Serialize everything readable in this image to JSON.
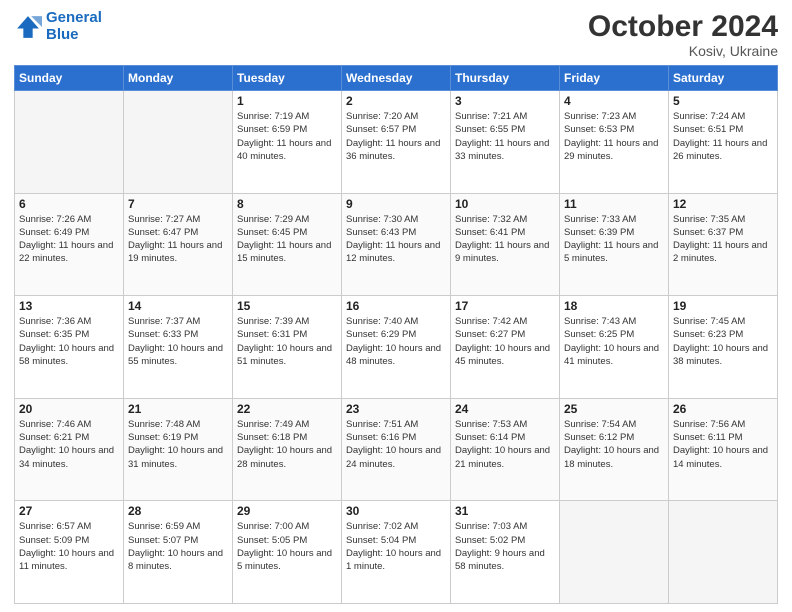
{
  "logo": {
    "line1": "General",
    "line2": "Blue"
  },
  "title": "October 2024",
  "subtitle": "Kosiv, Ukraine",
  "days": [
    "Sunday",
    "Monday",
    "Tuesday",
    "Wednesday",
    "Thursday",
    "Friday",
    "Saturday"
  ],
  "weeks": [
    [
      {
        "day": "",
        "info": ""
      },
      {
        "day": "",
        "info": ""
      },
      {
        "day": "1",
        "info": "Sunrise: 7:19 AM\nSunset: 6:59 PM\nDaylight: 11 hours and 40 minutes."
      },
      {
        "day": "2",
        "info": "Sunrise: 7:20 AM\nSunset: 6:57 PM\nDaylight: 11 hours and 36 minutes."
      },
      {
        "day": "3",
        "info": "Sunrise: 7:21 AM\nSunset: 6:55 PM\nDaylight: 11 hours and 33 minutes."
      },
      {
        "day": "4",
        "info": "Sunrise: 7:23 AM\nSunset: 6:53 PM\nDaylight: 11 hours and 29 minutes."
      },
      {
        "day": "5",
        "info": "Sunrise: 7:24 AM\nSunset: 6:51 PM\nDaylight: 11 hours and 26 minutes."
      }
    ],
    [
      {
        "day": "6",
        "info": "Sunrise: 7:26 AM\nSunset: 6:49 PM\nDaylight: 11 hours and 22 minutes."
      },
      {
        "day": "7",
        "info": "Sunrise: 7:27 AM\nSunset: 6:47 PM\nDaylight: 11 hours and 19 minutes."
      },
      {
        "day": "8",
        "info": "Sunrise: 7:29 AM\nSunset: 6:45 PM\nDaylight: 11 hours and 15 minutes."
      },
      {
        "day": "9",
        "info": "Sunrise: 7:30 AM\nSunset: 6:43 PM\nDaylight: 11 hours and 12 minutes."
      },
      {
        "day": "10",
        "info": "Sunrise: 7:32 AM\nSunset: 6:41 PM\nDaylight: 11 hours and 9 minutes."
      },
      {
        "day": "11",
        "info": "Sunrise: 7:33 AM\nSunset: 6:39 PM\nDaylight: 11 hours and 5 minutes."
      },
      {
        "day": "12",
        "info": "Sunrise: 7:35 AM\nSunset: 6:37 PM\nDaylight: 11 hours and 2 minutes."
      }
    ],
    [
      {
        "day": "13",
        "info": "Sunrise: 7:36 AM\nSunset: 6:35 PM\nDaylight: 10 hours and 58 minutes."
      },
      {
        "day": "14",
        "info": "Sunrise: 7:37 AM\nSunset: 6:33 PM\nDaylight: 10 hours and 55 minutes."
      },
      {
        "day": "15",
        "info": "Sunrise: 7:39 AM\nSunset: 6:31 PM\nDaylight: 10 hours and 51 minutes."
      },
      {
        "day": "16",
        "info": "Sunrise: 7:40 AM\nSunset: 6:29 PM\nDaylight: 10 hours and 48 minutes."
      },
      {
        "day": "17",
        "info": "Sunrise: 7:42 AM\nSunset: 6:27 PM\nDaylight: 10 hours and 45 minutes."
      },
      {
        "day": "18",
        "info": "Sunrise: 7:43 AM\nSunset: 6:25 PM\nDaylight: 10 hours and 41 minutes."
      },
      {
        "day": "19",
        "info": "Sunrise: 7:45 AM\nSunset: 6:23 PM\nDaylight: 10 hours and 38 minutes."
      }
    ],
    [
      {
        "day": "20",
        "info": "Sunrise: 7:46 AM\nSunset: 6:21 PM\nDaylight: 10 hours and 34 minutes."
      },
      {
        "day": "21",
        "info": "Sunrise: 7:48 AM\nSunset: 6:19 PM\nDaylight: 10 hours and 31 minutes."
      },
      {
        "day": "22",
        "info": "Sunrise: 7:49 AM\nSunset: 6:18 PM\nDaylight: 10 hours and 28 minutes."
      },
      {
        "day": "23",
        "info": "Sunrise: 7:51 AM\nSunset: 6:16 PM\nDaylight: 10 hours and 24 minutes."
      },
      {
        "day": "24",
        "info": "Sunrise: 7:53 AM\nSunset: 6:14 PM\nDaylight: 10 hours and 21 minutes."
      },
      {
        "day": "25",
        "info": "Sunrise: 7:54 AM\nSunset: 6:12 PM\nDaylight: 10 hours and 18 minutes."
      },
      {
        "day": "26",
        "info": "Sunrise: 7:56 AM\nSunset: 6:11 PM\nDaylight: 10 hours and 14 minutes."
      }
    ],
    [
      {
        "day": "27",
        "info": "Sunrise: 6:57 AM\nSunset: 5:09 PM\nDaylight: 10 hours and 11 minutes."
      },
      {
        "day": "28",
        "info": "Sunrise: 6:59 AM\nSunset: 5:07 PM\nDaylight: 10 hours and 8 minutes."
      },
      {
        "day": "29",
        "info": "Sunrise: 7:00 AM\nSunset: 5:05 PM\nDaylight: 10 hours and 5 minutes."
      },
      {
        "day": "30",
        "info": "Sunrise: 7:02 AM\nSunset: 5:04 PM\nDaylight: 10 hours and 1 minute."
      },
      {
        "day": "31",
        "info": "Sunrise: 7:03 AM\nSunset: 5:02 PM\nDaylight: 9 hours and 58 minutes."
      },
      {
        "day": "",
        "info": ""
      },
      {
        "day": "",
        "info": ""
      }
    ]
  ]
}
